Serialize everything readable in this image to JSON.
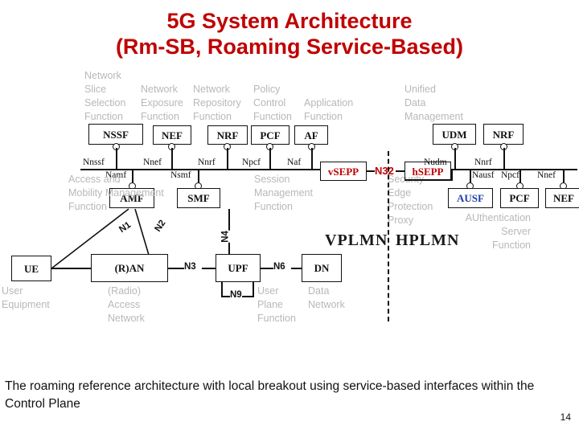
{
  "slide": {
    "title_line1": "5G System Architecture",
    "title_line2": "(Rm-SB, Roaming Service-Based)",
    "title_color": "#C00000",
    "footer": "The roaming reference architecture with local breakout using service-based interfaces within the Control Plane",
    "page_number": "14"
  },
  "plmn_labels": {
    "visited": "VPLMN",
    "home": "HPLMN"
  },
  "vplmn": {
    "bus_functions": [
      {
        "box": "NSSF",
        "interface": "Nnssf",
        "caption": "Network\nSlice\nSelection\nFunction"
      },
      {
        "box": "NEF",
        "interface": "Nnef",
        "caption": "Network\nExposure\nFunction"
      },
      {
        "box": "NRF",
        "interface": "Nnrf",
        "caption": "Network\nRepository\nFunction"
      },
      {
        "box": "PCF",
        "interface": "Npcf",
        "caption": "Policy\nControl\nFunction"
      },
      {
        "box": "AF",
        "interface": "Naf",
        "caption": "Application\nFunction"
      }
    ],
    "below_bus_functions": [
      {
        "box": "AMF",
        "interface": "Namf",
        "caption": "Access and\nMobility Management\nFunction"
      },
      {
        "box": "SMF",
        "interface": "Nsmf",
        "caption": "Session\nManagement\nFunction"
      }
    ],
    "user_plane": [
      {
        "box": "UE",
        "caption": "User\nEquipment"
      },
      {
        "box": "(R)AN",
        "caption": "(Radio)\nAccess\nNetwork"
      },
      {
        "box": "UPF",
        "caption": "User\nPlane\nFunction"
      },
      {
        "box": "DN",
        "caption": "Data\nNetwork"
      }
    ],
    "sepp": {
      "box": "vSEPP",
      "caption": "Security\nEdge\nProtection\nProxy",
      "color": "#C00000"
    }
  },
  "hplmn": {
    "sepp": {
      "box": "hSEPP",
      "color": "#C00000"
    },
    "bus_functions": [
      {
        "box": "UDM",
        "interface": "Nudm",
        "caption": "Unified\nData\nManagement"
      },
      {
        "box": "NRF",
        "interface": "Nnrf",
        "caption": ""
      }
    ],
    "below_bus_functions": [
      {
        "box": "AUSF",
        "interface": "Nausf",
        "caption": "AUthentication\nServer\nFunction",
        "color": "#1F3FA8"
      },
      {
        "box": "PCF",
        "interface": "Npcf",
        "caption": ""
      },
      {
        "box": "NEF",
        "interface": "Nnef",
        "caption": ""
      }
    ]
  },
  "reference_points": [
    {
      "label": "N1"
    },
    {
      "label": "N2"
    },
    {
      "label": "N3"
    },
    {
      "label": "N4"
    },
    {
      "label": "N6"
    },
    {
      "label": "N9"
    },
    {
      "label": "N32",
      "color": "#C00000"
    }
  ]
}
